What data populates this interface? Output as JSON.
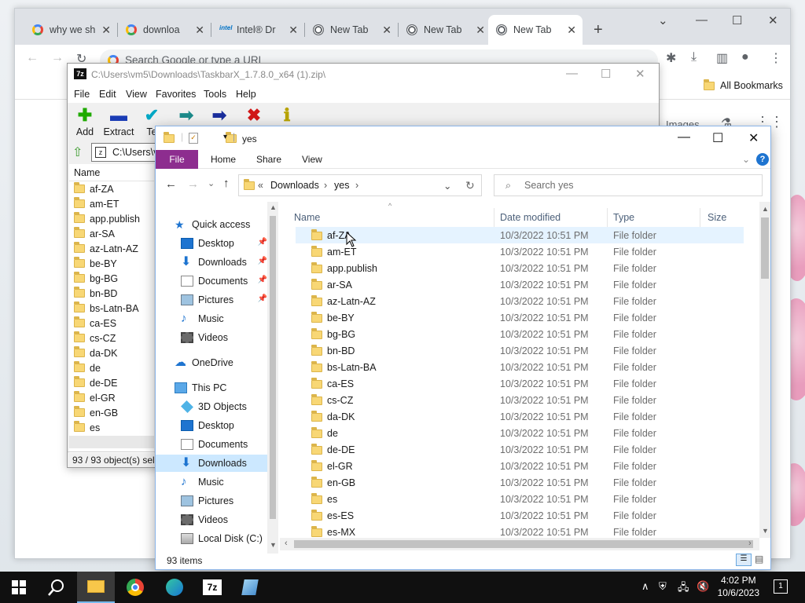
{
  "chrome": {
    "tabs": [
      {
        "label": "why we sh",
        "favicon": "google-icon"
      },
      {
        "label": "downloa",
        "favicon": "google-icon"
      },
      {
        "label": "Intel® Dr",
        "favicon": "intel-icon"
      },
      {
        "label": "New Tab",
        "favicon": "chrome-icon"
      },
      {
        "label": "New Tab",
        "favicon": "chrome-icon"
      },
      {
        "label": "New Tab",
        "favicon": "chrome-icon"
      }
    ],
    "new_tab": "+",
    "omnibox_placeholder": "Search Google or type a URL",
    "bookmarks_label": "All Bookmarks",
    "images_label": "Images"
  },
  "sevenzip": {
    "title": "C:\\Users\\vm5\\Downloads\\TaskbarX_1.7.8.0_x64 (1).zip\\",
    "app_icon": "7z",
    "menu": [
      "File",
      "Edit",
      "View",
      "Favorites",
      "Tools",
      "Help"
    ],
    "tools": [
      {
        "label": "Add",
        "icon": "plus-icon",
        "color": "#1faa00"
      },
      {
        "label": "Extract",
        "icon": "minus-icon",
        "color": "#1a3cb5"
      },
      {
        "label": "Te",
        "icon": "check-icon",
        "color": "#00a7c4"
      },
      {
        "label": "",
        "icon": "copy-arrow-icon",
        "color": "#1c8a8a"
      },
      {
        "label": "",
        "icon": "move-arrow-icon",
        "color": "#1a2e9c"
      },
      {
        "label": "",
        "icon": "delete-x-icon",
        "color": "#d11818"
      },
      {
        "label": "",
        "icon": "info-icon",
        "color": "#b8a300"
      }
    ],
    "address": "C:\\Users\\v",
    "column_name": "Name",
    "items": [
      "af-ZA",
      "am-ET",
      "app.publish",
      "ar-SA",
      "az-Latn-AZ",
      "be-BY",
      "bg-BG",
      "bn-BD",
      "bs-Latn-BA",
      "ca-ES",
      "cs-CZ",
      "da-DK",
      "de",
      "de-DE",
      "el-GR",
      "en-GB",
      "es"
    ],
    "status": "93 / 93 object(s) sele"
  },
  "explorer": {
    "title": "yes",
    "ribbon_tabs": [
      "File",
      "Home",
      "Share",
      "View"
    ],
    "breadcrumb": [
      "Downloads",
      "yes"
    ],
    "breadcrumb_prefix": "«",
    "search_placeholder": "Search yes",
    "nav": {
      "quick_access": "Quick access",
      "quick_items": [
        "Desktop",
        "Downloads",
        "Documents",
        "Pictures",
        "Music",
        "Videos"
      ],
      "onedrive": "OneDrive",
      "this_pc": "This PC",
      "pc_items": [
        "3D Objects",
        "Desktop",
        "Documents",
        "Downloads",
        "Music",
        "Pictures",
        "Videos",
        "Local Disk (C:)"
      ]
    },
    "columns": {
      "name": "Name",
      "date": "Date modified",
      "type": "Type",
      "size": "Size"
    },
    "rows": [
      {
        "name": "af-ZA",
        "date": "10/3/2022 10:51 PM",
        "type": "File folder"
      },
      {
        "name": "am-ET",
        "date": "10/3/2022 10:51 PM",
        "type": "File folder"
      },
      {
        "name": "app.publish",
        "date": "10/3/2022 10:51 PM",
        "type": "File folder"
      },
      {
        "name": "ar-SA",
        "date": "10/3/2022 10:51 PM",
        "type": "File folder"
      },
      {
        "name": "az-Latn-AZ",
        "date": "10/3/2022 10:51 PM",
        "type": "File folder"
      },
      {
        "name": "be-BY",
        "date": "10/3/2022 10:51 PM",
        "type": "File folder"
      },
      {
        "name": "bg-BG",
        "date": "10/3/2022 10:51 PM",
        "type": "File folder"
      },
      {
        "name": "bn-BD",
        "date": "10/3/2022 10:51 PM",
        "type": "File folder"
      },
      {
        "name": "bs-Latn-BA",
        "date": "10/3/2022 10:51 PM",
        "type": "File folder"
      },
      {
        "name": "ca-ES",
        "date": "10/3/2022 10:51 PM",
        "type": "File folder"
      },
      {
        "name": "cs-CZ",
        "date": "10/3/2022 10:51 PM",
        "type": "File folder"
      },
      {
        "name": "da-DK",
        "date": "10/3/2022 10:51 PM",
        "type": "File folder"
      },
      {
        "name": "de",
        "date": "10/3/2022 10:51 PM",
        "type": "File folder"
      },
      {
        "name": "de-DE",
        "date": "10/3/2022 10:51 PM",
        "type": "File folder"
      },
      {
        "name": "el-GR",
        "date": "10/3/2022 10:51 PM",
        "type": "File folder"
      },
      {
        "name": "en-GB",
        "date": "10/3/2022 10:51 PM",
        "type": "File folder"
      },
      {
        "name": "es",
        "date": "10/3/2022 10:51 PM",
        "type": "File folder"
      },
      {
        "name": "es-ES",
        "date": "10/3/2022 10:51 PM",
        "type": "File folder"
      },
      {
        "name": "es-MX",
        "date": "10/3/2022 10:51 PM",
        "type": "File folder"
      }
    ],
    "item_count": "93 items"
  },
  "taskbar": {
    "time": "4:02 PM",
    "date": "10/6/2023",
    "notification_count": "1",
    "apps": [
      "file-explorer-icon",
      "chrome-icon",
      "edge-icon",
      "7zip-icon",
      "notepad-icon"
    ]
  }
}
